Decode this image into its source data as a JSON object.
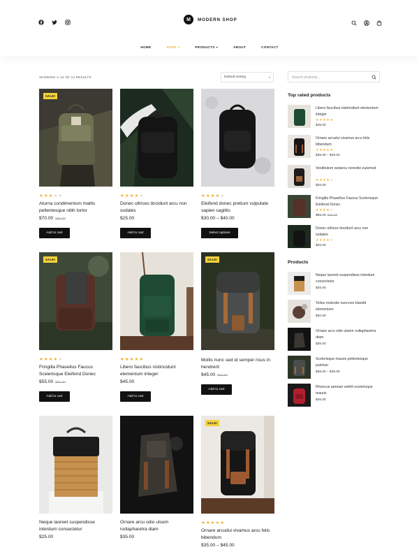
{
  "brand": {
    "logo_letter": "M",
    "name": "MODERN SHOP"
  },
  "social": [
    "facebook-icon",
    "twitter-icon",
    "instagram-icon"
  ],
  "header_icons": [
    "search-icon",
    "user-icon",
    "cart-icon"
  ],
  "nav": [
    {
      "label": "HOME",
      "active": false,
      "dropdown": false
    },
    {
      "label": "SHOP",
      "active": true,
      "dropdown": true
    },
    {
      "label": "PRODUCTS",
      "active": false,
      "dropdown": true
    },
    {
      "label": "ABOUT",
      "active": false,
      "dropdown": false
    },
    {
      "label": "CONTACT",
      "active": false,
      "dropdown": false
    }
  ],
  "toolbar": {
    "result_count": "SHOWING 1–12 OF 13 RESULTS",
    "sort_label": "Default sorting"
  },
  "colors": {
    "accent": "#f0b030",
    "sale": "#f5d33b",
    "button": "#111111"
  },
  "products": [
    {
      "name": "Aturna condimentum mattis pellentesque nibh tortor",
      "rating": 3,
      "price": "$70.00",
      "old_price": "$90.00",
      "sale": true,
      "button": "Add to cart"
    },
    {
      "name": "Donec ultrices tincidunt arcu non sodales",
      "rating": 4,
      "price": "$25.00",
      "old_price": "",
      "sale": false,
      "button": "Add to cart"
    },
    {
      "name": "Eleifend donec pretium vulputate sapien sagittis",
      "rating": 4,
      "price": "$30.00 – $40.00",
      "old_price": "",
      "sale": false,
      "button": "Select options"
    },
    {
      "name": "Fringilla Phasellus Faucus Scelerisque Eleifend Donec",
      "rating": 4,
      "price": "$55.00",
      "old_price": "$80.00",
      "sale": true,
      "button": "Add to cart"
    },
    {
      "name": "Libero faucibus nistincidunt elementum integer",
      "rating": 5,
      "price": "$45.00",
      "old_price": "",
      "sale": false,
      "button": "Add to cart"
    },
    {
      "name": "Mollis nunc sed id semper risus in hendrerit",
      "rating": 0,
      "price": "$45.00",
      "old_price": "$60.00",
      "sale": true,
      "button": "Add to cart"
    },
    {
      "name": "Neque laoreet suspendisse interdum consectetur",
      "rating": 0,
      "price": "$25.00",
      "old_price": "",
      "sale": false,
      "button": ""
    },
    {
      "name": "Ornare arcu odio utsem nullapharetra diam",
      "rating": 0,
      "price": "$35.00",
      "old_price": "",
      "sale": false,
      "button": ""
    },
    {
      "name": "Ornare arcudui vivamus arcu felis bibendum",
      "rating": 5,
      "price": "$35.00 – $45.00",
      "old_price": "",
      "sale": true,
      "button": ""
    }
  ],
  "sidebar": {
    "search_placeholder": "Search products...",
    "top_rated_title": "Top rated products",
    "top_rated": [
      {
        "name": "Libero faucibus nistincidunt elementum integer",
        "rating": 5,
        "price": "$45.00",
        "old_price": ""
      },
      {
        "name": "Ornare arcudui vivamus arcu felis bibendum",
        "rating": 5,
        "price": "$35.00 – $45.00",
        "old_price": ""
      },
      {
        "name": "Vestibulum sedarcu nonodio euismod",
        "rating": 4,
        "price": "$25.00",
        "old_price": ""
      },
      {
        "name": "Fringilla Phasellus Faucus Scelerisque Eleifend Donec",
        "rating": 4,
        "price": "$55.00",
        "old_price": "$80.00"
      },
      {
        "name": "Donec ultrices tincidunt arcu non sodales",
        "rating": 4,
        "price": "$25.00",
        "old_price": ""
      }
    ],
    "products_title": "Products",
    "products": [
      {
        "name": "Neque laoreet suspendisse interdum consectetur",
        "price": "$25.00"
      },
      {
        "name": "Tellus molestie nuncnon blandit elementum",
        "price": "$30.00"
      },
      {
        "name": "Ornare arcu odio utsem nullapharetra diam",
        "price": "$35.00"
      },
      {
        "name": "Scelerisque mauris pellentesque pulvinar",
        "price": "$35.00 – $45.00"
      },
      {
        "name": "Rhoncus aenean velelit scelerisque mauris",
        "price": "$45.00"
      }
    ]
  }
}
